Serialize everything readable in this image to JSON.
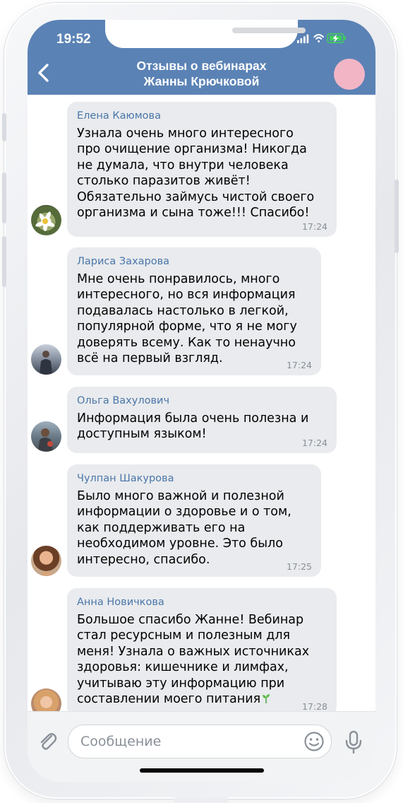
{
  "status_bar": {
    "time": "19:52"
  },
  "header": {
    "title_line1": "Отзывы о вебинарах",
    "title_line2": "Жанны Крючковой"
  },
  "messages": [
    {
      "sender": "Елена Каюмова",
      "lines": [
        "Узнала очень много интересного",
        "про очищение организма! Никогда",
        "не думала, что внутри человека",
        "столько паразитов живёт!",
        "Обязательно займусь чистой своего",
        "организма и сына тоже!!! Спасибо!"
      ],
      "time": "17:24"
    },
    {
      "sender": "Лариса Захарова",
      "lines": [
        "Мне очень понравилось, много",
        "интересного, но вся информация",
        "подавалась настолько в легкой,",
        "популярной форме, что я не могу",
        "доверять всему. Как то ненаучно",
        "всё на первый взгляд."
      ],
      "time": "17:24"
    },
    {
      "sender": "Ольга Вахулович",
      "lines": [
        "Информация была очень полезна и",
        "доступным языком!"
      ],
      "time": "17:24"
    },
    {
      "sender": "Чулпан Шакурова",
      "lines": [
        "Было много важной и полезной",
        "информации о здоровье и о том,",
        "как поддерживать его на",
        "необходимом уровне. Это было",
        "интересно, спасибо."
      ],
      "time": "17:25"
    },
    {
      "sender": "Анна Новичкова",
      "lines": [
        "Большое спасибо Жанне! Вебинар",
        "стал ресурсным и полезным для",
        "меня! Узнала о важных источниках",
        "здоровья: кишечнике и лимфах,",
        "учитываю эту информацию при",
        "составлении моего питания"
      ],
      "time": "17:28"
    }
  ],
  "composer": {
    "placeholder": "Сообщение"
  },
  "icons": {
    "back": "back-arrow-icon",
    "signal": "signal-icon",
    "wifi": "wifi-icon",
    "battery": "battery-charging-icon",
    "attach": "paperclip-icon",
    "emoji": "smile-icon",
    "mic": "microphone-icon",
    "sprout": "sprout-emoji-icon"
  },
  "colors": {
    "header": "#5a82b5",
    "bubble": "#e9ebee",
    "sender": "#4a76a8",
    "avatar_top": "#f1b5c6",
    "battery": "#3fce5a"
  }
}
